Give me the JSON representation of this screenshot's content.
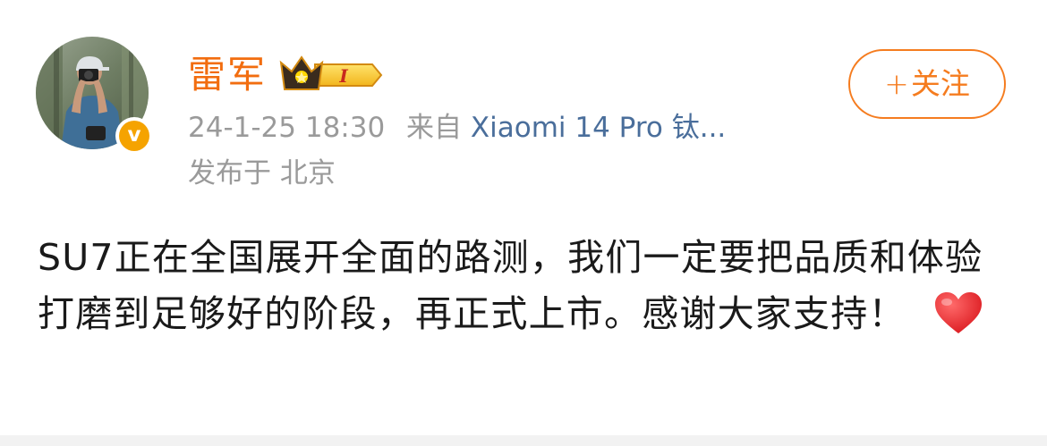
{
  "user": {
    "name": "雷军",
    "verified_mark": "v",
    "vip_level": "I"
  },
  "meta": {
    "timestamp": "24-1-25 18:30",
    "source_prefix": "来自",
    "source": "Xiaomi 14 Pro 钛...",
    "location": "发布于 北京"
  },
  "follow_button": {
    "plus": "+",
    "label": "关注"
  },
  "post": {
    "text": "SU7正在全国展开全面的路测，我们一定要把品质和体验打磨到足够好的阶段，再正式上市。感谢大家支持！",
    "emoji": "heart-icon"
  },
  "colors": {
    "username": "#f26d0f",
    "source_link": "#4a6e9b",
    "meta_gray": "#9a9a9a",
    "follow_accent": "#f57c1f",
    "heart": "#e8262d"
  }
}
